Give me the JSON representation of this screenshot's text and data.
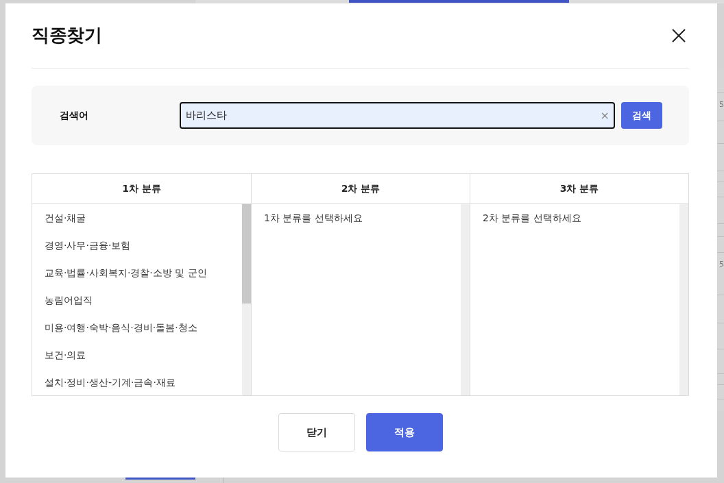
{
  "dialog": {
    "title": "직종찾기"
  },
  "search": {
    "label": "검색어",
    "value": "바리스타",
    "clear_button": "×",
    "button": "검색"
  },
  "categories": [
    {
      "heading": "1차 분류",
      "items": [
        {
          "label": "건설·채굴",
          "selected": false
        },
        {
          "label": "경영·사무·금융·보험",
          "selected": false
        },
        {
          "label": "교육·법률·사회복지·경찰·소방 및 군인",
          "selected": false
        },
        {
          "label": "농림어업직",
          "selected": false
        },
        {
          "label": "미용·여행·숙박·음식·경비·돌봄·청소",
          "selected": false
        },
        {
          "label": "보건·의료",
          "selected": false
        },
        {
          "label": "설치·정비·생산-기계·금속·재료",
          "selected": false
        }
      ]
    },
    {
      "heading": "2차 분류",
      "message": "1차 분류를 선택하세요"
    },
    {
      "heading": "3차 분류",
      "message": "2차 분류를 선택하세요"
    }
  ],
  "buttons": [
    {
      "label": "닫기",
      "kind": "secondary"
    },
    {
      "label": "적용",
      "kind": "primary"
    }
  ],
  "background": {
    "edge_texts": [
      "5",
      "5"
    ]
  }
}
